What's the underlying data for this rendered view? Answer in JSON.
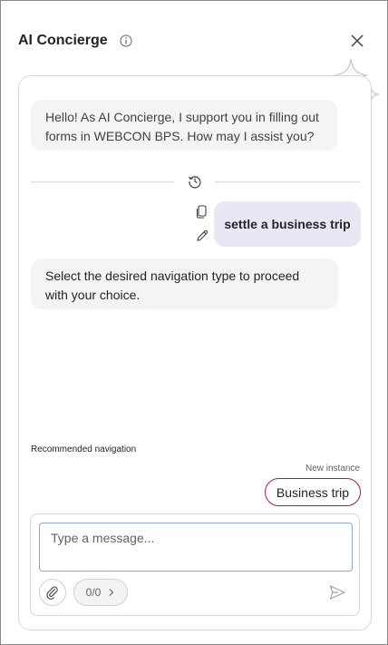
{
  "header": {
    "title": "AI Concierge",
    "info_icon": "info-icon",
    "close_icon": "close-icon"
  },
  "chat": {
    "messages": [
      {
        "role": "assistant",
        "text": "Hello! As AI Concierge, I support you in filling out forms in WEBCON BPS. How may I assist you?"
      },
      {
        "role": "user",
        "text": "settle a business trip"
      },
      {
        "role": "assistant",
        "text": "Select the desired navigation type to proceed with your choice."
      }
    ],
    "history_icon": "history-icon",
    "user_actions": [
      "copy-icon",
      "edit-icon"
    ]
  },
  "recommended": {
    "label": "Recommended navigation",
    "group_label": "New instance",
    "chip_label": "Business trip",
    "chip_border_color": "#a3195b"
  },
  "composer": {
    "placeholder": "Type a message...",
    "value": "",
    "counter": "0/0",
    "attach_icon": "paperclip-icon",
    "send_icon": "send-icon"
  },
  "colors": {
    "user_bubble": "#e8e8f5",
    "bot_bubble": "#f4f4f4",
    "accent_chip": "#a3195b",
    "input_border": "#8fa7d6"
  }
}
